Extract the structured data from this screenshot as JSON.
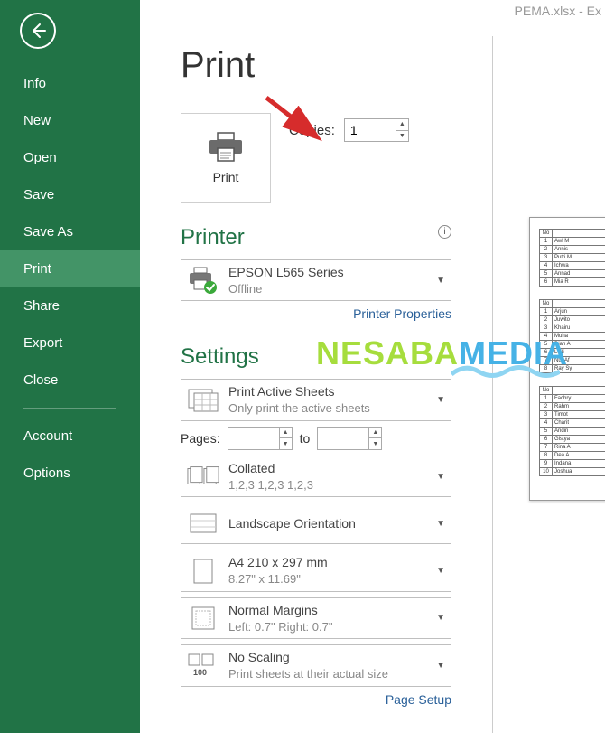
{
  "titlebar": "PEMA.xlsx - Ex",
  "sidebar": {
    "items": [
      "Info",
      "New",
      "Open",
      "Save",
      "Save As",
      "Print",
      "Share",
      "Export",
      "Close"
    ],
    "active_index": 5,
    "footer_items": [
      "Account",
      "Options"
    ]
  },
  "page": {
    "title": "Print",
    "print_tile_label": "Print",
    "copies_label": "Copies:",
    "copies_value": "1"
  },
  "printer": {
    "section_title": "Printer",
    "name": "EPSON L565 Series",
    "status": "Offline",
    "properties_link": "Printer Properties"
  },
  "settings": {
    "section_title": "Settings",
    "print_what": {
      "label": "Print Active Sheets",
      "sub": "Only print the active sheets"
    },
    "pages_label": "Pages:",
    "pages_from": "",
    "pages_to_label": "to",
    "pages_to": "",
    "collation": {
      "label": "Collated",
      "sub": "1,2,3      1,2,3      1,2,3"
    },
    "orientation": "Landscape Orientation",
    "paper": {
      "label": "A4 210 x 297 mm",
      "sub": "8.27\" x 11.69\""
    },
    "margins": {
      "label": "Normal Margins",
      "sub": "Left:  0.7\"     Right:  0.7\""
    },
    "scaling": {
      "label": "No Scaling",
      "sub": "Print sheets at their actual size"
    },
    "page_setup_link": "Page Setup"
  },
  "preview": {
    "tables": [
      {
        "header": "No",
        "rows": [
          [
            1,
            "Awl M"
          ],
          [
            2,
            "Annis"
          ],
          [
            3,
            "Putri M"
          ],
          [
            4,
            "Ichwa"
          ],
          [
            5,
            "Annad"
          ],
          [
            6,
            "Mia R"
          ]
        ]
      },
      {
        "header": "No",
        "rows": [
          [
            1,
            "Arjun"
          ],
          [
            2,
            "Juwito"
          ],
          [
            3,
            "Khairu"
          ],
          [
            4,
            "Muha"
          ],
          [
            5,
            "Dian A"
          ],
          [
            6,
            "Leili"
          ],
          [
            7,
            "Nur Af"
          ],
          [
            8,
            "Ray Sy"
          ]
        ]
      },
      {
        "header": "No",
        "rows": [
          [
            1,
            "Fachry"
          ],
          [
            2,
            "Rahm"
          ],
          [
            3,
            "Timot"
          ],
          [
            4,
            "Charit"
          ],
          [
            5,
            "Andin"
          ],
          [
            6,
            "Gistya"
          ],
          [
            7,
            "Rina A"
          ],
          [
            8,
            "Dea A"
          ],
          [
            9,
            "Indana"
          ],
          [
            10,
            "Joshua"
          ]
        ]
      }
    ]
  },
  "watermark": {
    "part1": "NESABA",
    "part2": "MEDIA"
  }
}
